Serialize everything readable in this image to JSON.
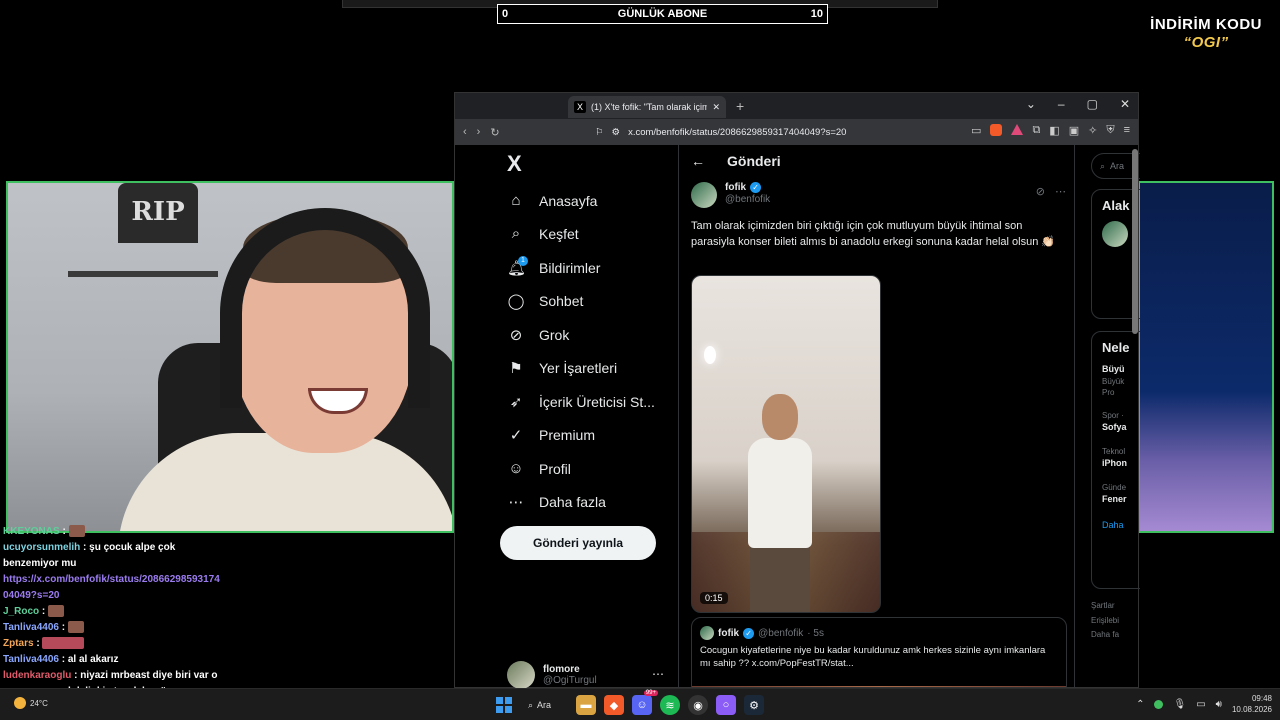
{
  "overlay": {
    "sub_left": "0",
    "sub_label": "GÜNLÜK ABONE",
    "sub_right": "10",
    "sub_progress": 0,
    "promo_line1": "İNDİRİM KODU",
    "promo_line2": "“OGI”"
  },
  "webcam": {
    "sign": "RIP"
  },
  "chat": [
    {
      "user": "KKEYONAS",
      "text": "",
      "emote": true,
      "userColor": "u1"
    },
    {
      "user": "ucuyorsunmelih",
      "text": ": şu çocuk alpe çok benzemiyor mu",
      "userColor": "u2"
    },
    {
      "link": "https://x.com/benfofik/status/2086629859317404049?s=20"
    },
    {
      "user": "J_Roco",
      "text": ":",
      "emote": true,
      "userColor": "u1"
    },
    {
      "user": "Tanliva4406",
      "text": ":",
      "emote": true,
      "userColor": "u3"
    },
    {
      "user": "Zptars",
      "text": ":",
      "emoteWide": true,
      "userColor": "u4"
    },
    {
      "user": "Tanliva4406",
      "text": ": al al akarız",
      "userColor": "u3"
    },
    {
      "user": "ludenkaraoglu",
      "text": ": niyazi mrbeast diye biri var o sana sponsorluk linki atacak bugün",
      "userColor": "u5"
    }
  ],
  "browser": {
    "tab_title": "(1) X'te fofik: \"Tam olarak içimizden",
    "tab_icon": "X",
    "url": "x.com/benfofik/status/2086629859317404049?s=20"
  },
  "nav": {
    "logo": "X",
    "items": [
      {
        "label": "Anasayfa",
        "icon": "home-icon",
        "glyph": "⌂"
      },
      {
        "label": "Keşfet",
        "icon": "search-icon",
        "glyph": "⌕"
      },
      {
        "label": "Bildirimler",
        "icon": "bell-icon",
        "glyph": "🔔︎"
      },
      {
        "label": "Sohbet",
        "icon": "chat-icon",
        "glyph": "◯"
      },
      {
        "label": "Grok",
        "icon": "grok-icon",
        "glyph": "⊘"
      },
      {
        "label": "Yer İşaretleri",
        "icon": "bookmark-icon",
        "glyph": "⚑"
      },
      {
        "label": "İçerik Üreticisi St...",
        "icon": "rocket-icon",
        "glyph": "➶"
      },
      {
        "label": "Premium",
        "icon": "premium-icon",
        "glyph": "✓"
      },
      {
        "label": "Profil",
        "icon": "profile-icon",
        "glyph": "☺"
      },
      {
        "label": "Daha fazla",
        "icon": "more-icon",
        "glyph": "⋯"
      }
    ],
    "notification_count": "1",
    "post_button": "Gönderi yayınla",
    "account_name": "flomore",
    "account_handle": "@OgiTurgul"
  },
  "post": {
    "header": "Gönderi",
    "author_name": "fofik",
    "author_handle": "@benfofik",
    "text": "Tam olarak içimizden biri çıktığı için çok mutluyum büyük ihtimal son parasiyla konser bileti almıs bi anadolu erkegi sonuna kadar helal olsun 👏🏻",
    "video_duration": "0:15",
    "quote": {
      "name": "fofik",
      "handle": "@benfofik",
      "time": "· 5s",
      "text": "Cocugun kiyafetlerine niye bu kadar kuruldunuz amk herkes sizinle aynı imkanlara mı sahip ?? x.com/PopFestTR/stat..."
    }
  },
  "sidebar": {
    "search_placeholder": "Ara",
    "box1_title": "Alak",
    "box2_title": "Nele",
    "trend1": "Büyü",
    "trend1_sub": "Büyük",
    "trend1_promo": "Pro",
    "trend2_cat": "Spor ·",
    "trend2": "Sofya",
    "trend3_cat": "Teknol",
    "trend3": "iPhon",
    "trend4_cat": "Günde",
    "trend4": "Fener",
    "more": "Daha",
    "footer1": "Şartlar",
    "footer2": "Erişilebi",
    "footer3": "Daha fa"
  },
  "taskbar": {
    "temp": "24°C",
    "search": "Ara",
    "time": "09:48",
    "date": "10.08.2026",
    "discord_badge": "99+"
  }
}
